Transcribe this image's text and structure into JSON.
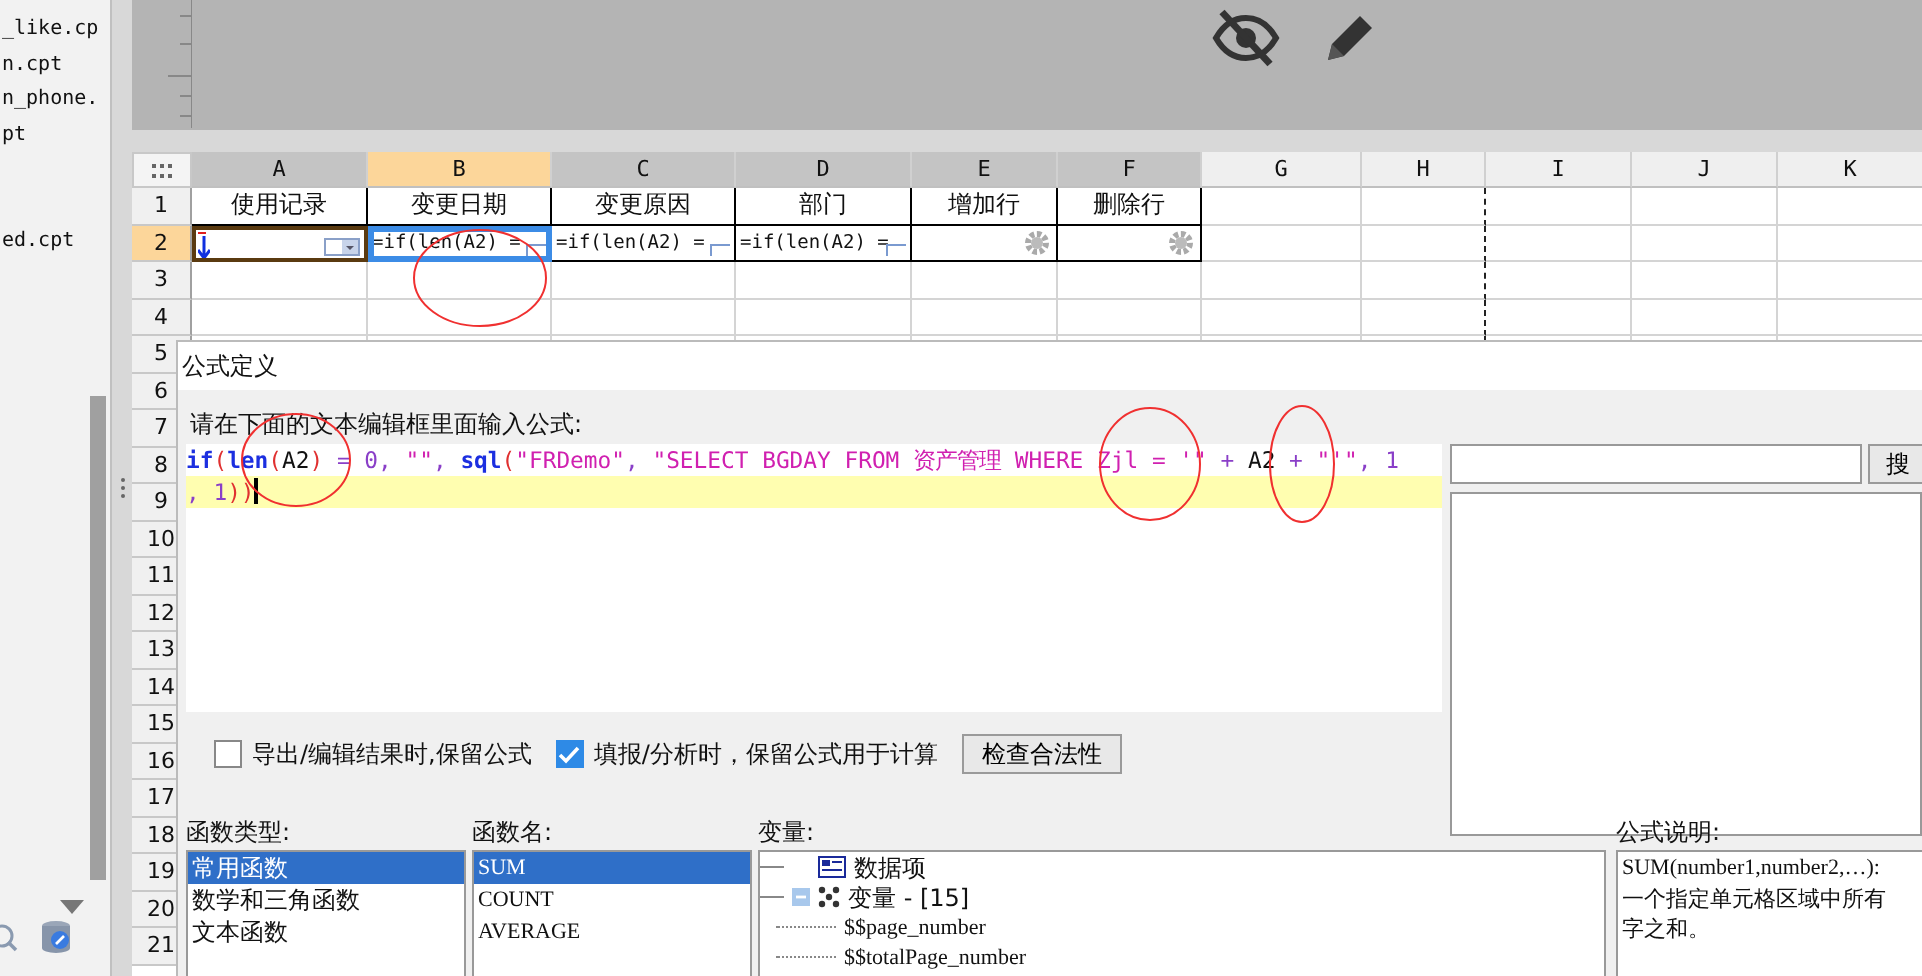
{
  "sidebar": {
    "files": [
      "_like.cp",
      "n.cpt",
      "n_phone.",
      "pt",
      "ed.cpt"
    ]
  },
  "sheet": {
    "columns": [
      {
        "label": "A",
        "selected": false
      },
      {
        "label": "B",
        "selected": true
      },
      {
        "label": "C",
        "selected": false
      },
      {
        "label": "D",
        "selected": false
      },
      {
        "label": "E",
        "selected": false
      },
      {
        "label": "F",
        "selected": false
      },
      {
        "label": "G",
        "selected": false
      },
      {
        "label": "H",
        "selected": false
      },
      {
        "label": "I",
        "selected": false
      },
      {
        "label": "J",
        "selected": false
      },
      {
        "label": "K",
        "selected": false
      }
    ],
    "rows": [
      {
        "label": "1",
        "selected": false,
        "cells": [
          {
            "kind": "text",
            "text": "使用记录",
            "selected": false
          },
          {
            "kind": "text",
            "text": "变更日期",
            "selected": false
          },
          {
            "kind": "text",
            "text": "变更原因",
            "selected": false
          },
          {
            "kind": "text",
            "text": "部门",
            "selected": false
          },
          {
            "kind": "text",
            "text": "增加行",
            "selected": false
          },
          {
            "kind": "text",
            "text": "删除行",
            "selected": false
          }
        ]
      },
      {
        "label": "2",
        "selected": true,
        "cells": [
          {
            "kind": "input",
            "selected": false
          },
          {
            "kind": "formula",
            "text": "=if(len(A2) =",
            "selected": true
          },
          {
            "kind": "formula",
            "text": "=if(len(A2) =",
            "selected": false
          },
          {
            "kind": "formula",
            "text": "=if(len(A2) =",
            "selected": false
          },
          {
            "kind": "widget",
            "selected": false
          },
          {
            "kind": "widget",
            "selected": false
          }
        ]
      },
      {
        "label": "3",
        "selected": false
      },
      {
        "label": "4",
        "selected": false
      },
      {
        "label": "5",
        "selected": false
      },
      {
        "label": "6",
        "selected": false
      },
      {
        "label": "7",
        "selected": false
      },
      {
        "label": "8",
        "selected": false
      },
      {
        "label": "9",
        "selected": false
      },
      {
        "label": "10",
        "selected": false
      },
      {
        "label": "11",
        "selected": false
      },
      {
        "label": "12",
        "selected": false
      },
      {
        "label": "13",
        "selected": false
      },
      {
        "label": "14",
        "selected": false
      },
      {
        "label": "15",
        "selected": false
      },
      {
        "label": "16",
        "selected": false
      },
      {
        "label": "17",
        "selected": false
      },
      {
        "label": "18",
        "selected": false
      },
      {
        "label": "19",
        "selected": false
      },
      {
        "label": "20",
        "selected": false
      },
      {
        "label": "21",
        "selected": false
      }
    ]
  },
  "dialog": {
    "title": "公式定义",
    "prompt": "请在下面的文本编辑框里面输入公式:",
    "formula_lines": [
      {
        "current": false,
        "tokens": [
          {
            "kind": "fn",
            "text": "if"
          },
          {
            "kind": "paren",
            "text": "("
          },
          {
            "kind": "fn",
            "text": "len"
          },
          {
            "kind": "paren",
            "text": "("
          },
          {
            "kind": "ref",
            "text": "A2"
          },
          {
            "kind": "paren",
            "text": ")"
          },
          {
            "kind": "op",
            "text": " = "
          },
          {
            "kind": "num",
            "text": "0"
          },
          {
            "kind": "op",
            "text": ", "
          },
          {
            "kind": "str",
            "text": "\"\""
          },
          {
            "kind": "op",
            "text": ", "
          },
          {
            "kind": "fn",
            "text": "sql"
          },
          {
            "kind": "paren",
            "text": "("
          },
          {
            "kind": "str",
            "text": "\"FRDemo\""
          },
          {
            "kind": "op",
            "text": ", "
          },
          {
            "kind": "str",
            "text": "\"SELECT BGDAY FROM 资产管理 WHERE Zjl = '\""
          },
          {
            "kind": "op",
            "text": " + "
          },
          {
            "kind": "ref",
            "text": "A2"
          },
          {
            "kind": "op",
            "text": " + "
          },
          {
            "kind": "str",
            "text": "\"'\""
          },
          {
            "kind": "op",
            "text": ", "
          },
          {
            "kind": "num",
            "text": "1"
          }
        ]
      },
      {
        "current": true,
        "tokens": [
          {
            "kind": "op",
            "text": ", "
          },
          {
            "kind": "num",
            "text": "1"
          },
          {
            "kind": "paren",
            "text": "))"
          }
        ]
      }
    ],
    "search": {
      "button": "搜"
    },
    "options": [
      {
        "label": "导出/编辑结果时,保留公式",
        "checked": false
      },
      {
        "label": "填报/分析时，保留公式用于计算",
        "checked": true
      }
    ],
    "check_button": "检查合法性",
    "function_types": {
      "label": "函数类型:",
      "items": [
        {
          "text": "常用函数",
          "selected": true
        },
        {
          "text": "数学和三角函数",
          "selected": false
        },
        {
          "text": "文本函数",
          "selected": false
        }
      ]
    },
    "function_names": {
      "label": "函数名:",
      "items": [
        {
          "text": "SUM",
          "selected": true
        },
        {
          "text": "COUNT",
          "selected": false
        },
        {
          "text": "AVERAGE",
          "selected": false
        }
      ]
    },
    "variables": {
      "label": "变量:",
      "items": [
        {
          "kind": "dataset",
          "text": "数据项"
        },
        {
          "kind": "group",
          "text": "变量 - [15]",
          "expanded": true,
          "children": [
            {
              "text": "$$page_number"
            },
            {
              "text": "$$totalPage_number"
            }
          ]
        }
      ]
    },
    "description": {
      "label": "公式说明:",
      "lines": [
        "SUM(number1,number2,…):",
        "一个指定单元格区域中所有",
        "字之和。"
      ]
    }
  }
}
